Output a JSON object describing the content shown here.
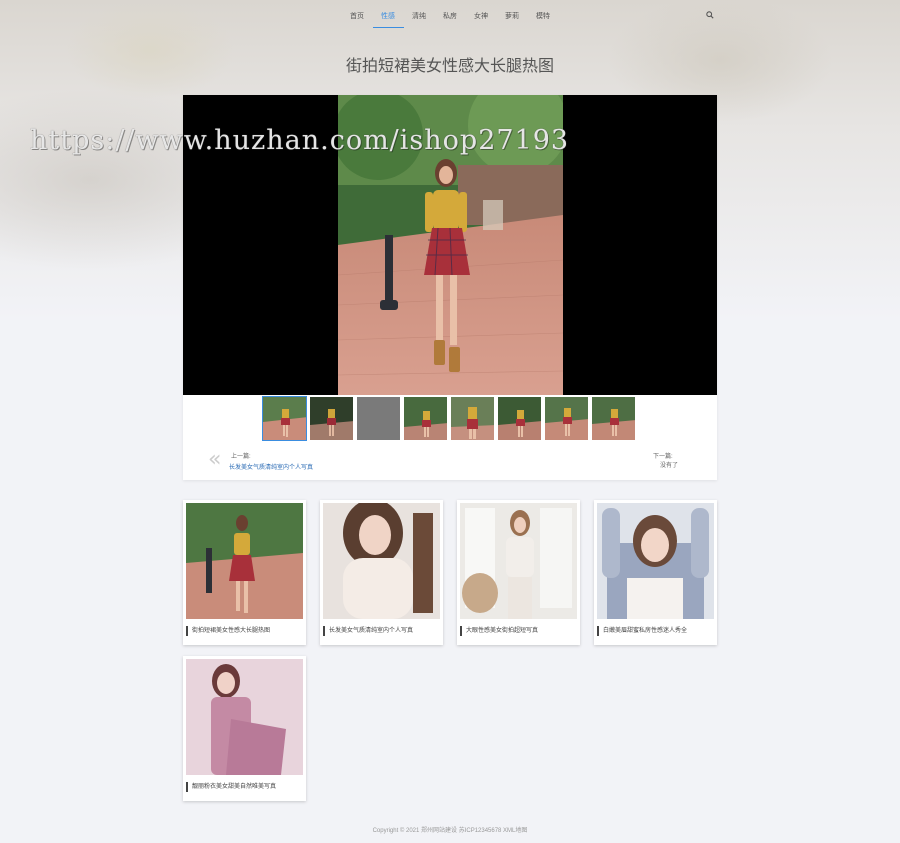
{
  "watermark": "https://www.huzhan.com/ishop27193",
  "nav": {
    "items": [
      "首页",
      "性感",
      "清纯",
      "私房",
      "女神",
      "萝莉",
      "模特"
    ],
    "active_index": 1,
    "search_icon": "search-icon"
  },
  "page_title": "街拍短裙美女性感大长腿热图",
  "gallery": {
    "thumb_count": 8,
    "active_thumb": 0,
    "prev_label": "上一篇:",
    "prev_link": "长发美女气质清纯室内个人写真",
    "next_label": "下一篇:",
    "next_text": "没有了"
  },
  "related": [
    {
      "caption": "街拍短裙美女性感大长腿热图"
    },
    {
      "caption": "长发美女气质清纯室内个人写真"
    },
    {
      "caption": "大眼性感美女街拍超短写真"
    },
    {
      "caption": "白嫩美眉甜蜜私房性感迷人秀全"
    },
    {
      "caption": "靓丽粉衣美女甜美自然唯美写真"
    }
  ],
  "footer": "Copyright © 2021 郑州网站建设  苏ICP12345678  XML地图"
}
